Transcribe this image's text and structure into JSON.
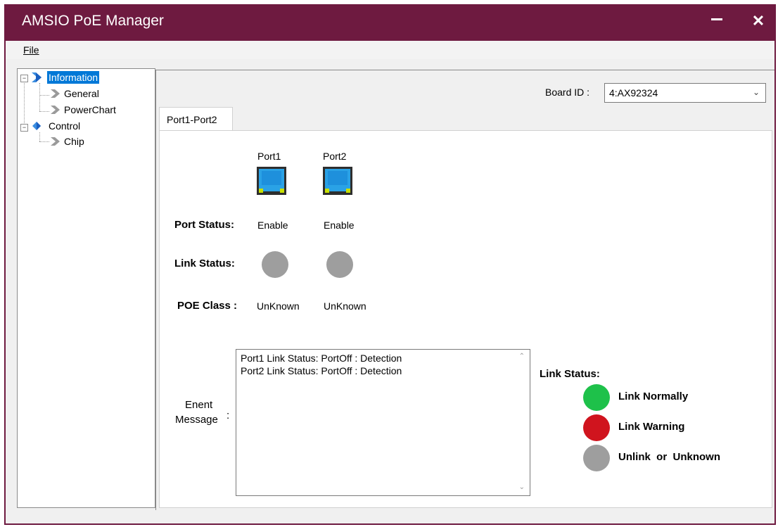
{
  "window": {
    "title": "AMSIO PoE Manager",
    "minimize_glyph": "—",
    "close_glyph": "✕"
  },
  "menu": {
    "file": "File"
  },
  "tree": {
    "items": [
      {
        "label": "Information",
        "selected": true
      },
      {
        "label": "General"
      },
      {
        "label": "PowerChart"
      },
      {
        "label": "Control"
      },
      {
        "label": "Chip"
      }
    ]
  },
  "board": {
    "label": "Board ID :",
    "value": "4:AX92324"
  },
  "tabs": [
    {
      "label": "Port1-Port2"
    }
  ],
  "ports": [
    {
      "name": "Port1",
      "status": "Enable",
      "poe_class": "UnKnown",
      "link_color": "#9e9e9e"
    },
    {
      "name": "Port2",
      "status": "Enable",
      "poe_class": "UnKnown",
      "link_color": "#9e9e9e"
    }
  ],
  "labels": {
    "port_status": "Port Status:",
    "link_status": "Link Status:",
    "poe_class": "POE Class :",
    "event_message_1": "Enent",
    "event_message_2": "Message",
    "event_colon": ":"
  },
  "events": [
    "Port1 Link Status: PortOff : Detection",
    "Port2 Link Status: PortOff : Detection"
  ],
  "legend": {
    "title": "Link Status:",
    "items": [
      {
        "label": "Link Normally",
        "color": "#1ec14a"
      },
      {
        "label": "Link Warning",
        "color": "#d0141e"
      },
      {
        "label": "Unlink  or  Unknown",
        "color": "#9e9e9e"
      }
    ]
  },
  "colors": {
    "title_bar": "#6e1a40",
    "selection": "#0078d7",
    "port_icon": "#1e9be0"
  }
}
